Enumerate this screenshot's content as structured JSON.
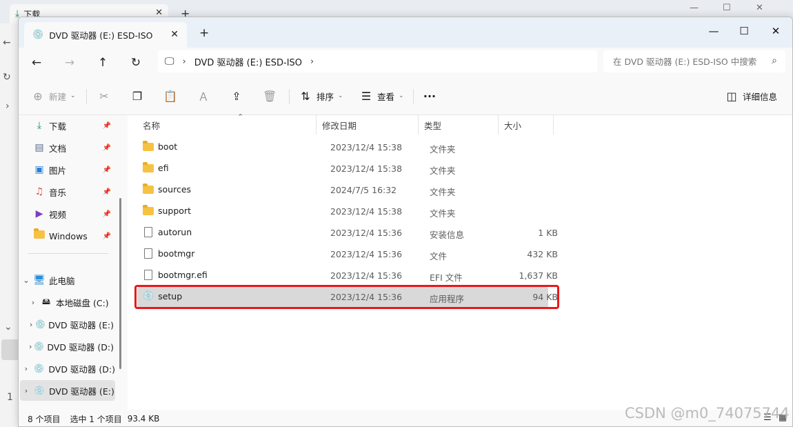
{
  "background_window": {
    "tab_label": "下载",
    "status_number": "1"
  },
  "window": {
    "tab": {
      "label": "DVD 驱动器 (E:) ESD-ISO"
    },
    "address": {
      "breadcrumb": "DVD 驱动器 (E:) ESD-ISO"
    },
    "search": {
      "placeholder": "在 DVD 驱动器 (E:) ESD-ISO 中搜索"
    },
    "commands": {
      "new": "新建",
      "sort": "排序",
      "view": "查看",
      "details": "详细信息"
    },
    "sidebar": {
      "quick": [
        {
          "label": "下载"
        },
        {
          "label": "文档"
        },
        {
          "label": "图片"
        },
        {
          "label": "音乐"
        },
        {
          "label": "视频"
        },
        {
          "label": "Windows"
        }
      ],
      "this_pc": "此电脑",
      "drives": [
        {
          "label": "本地磁盘 (C:)"
        },
        {
          "label": "DVD 驱动器 (E:)"
        },
        {
          "label": "DVD 驱动器 (D:)"
        }
      ],
      "root_drives": [
        {
          "label": "DVD 驱动器 (D:)"
        },
        {
          "label": "DVD 驱动器 (E:)"
        }
      ]
    },
    "columns": {
      "name": "名称",
      "date": "修改日期",
      "type": "类型",
      "size": "大小"
    },
    "files": [
      {
        "name": "boot",
        "date": "2023/12/4 15:38",
        "type": "文件夹",
        "size": ""
      },
      {
        "name": "efi",
        "date": "2023/12/4 15:38",
        "type": "文件夹",
        "size": ""
      },
      {
        "name": "sources",
        "date": "2024/7/5 16:32",
        "type": "文件夹",
        "size": ""
      },
      {
        "name": "support",
        "date": "2023/12/4 15:38",
        "type": "文件夹",
        "size": ""
      },
      {
        "name": "autorun",
        "date": "2023/12/4 15:36",
        "type": "安装信息",
        "size": "1 KB"
      },
      {
        "name": "bootmgr",
        "date": "2023/12/4 15:36",
        "type": "文件",
        "size": "432 KB"
      },
      {
        "name": "bootmgr.efi",
        "date": "2023/12/4 15:36",
        "type": "EFI 文件",
        "size": "1,637 KB"
      },
      {
        "name": "setup",
        "date": "2023/12/4 15:36",
        "type": "应用程序",
        "size": "94 KB"
      }
    ],
    "status": {
      "item_count": "8 个项目",
      "selected": "选中 1 个项目",
      "selected_size": "93.4 KB"
    }
  },
  "watermark": "CSDN @m0_74075744",
  "colors": {
    "highlight": "#e8181c",
    "selection": "#d9d9d9",
    "folder": "#f6c243"
  }
}
